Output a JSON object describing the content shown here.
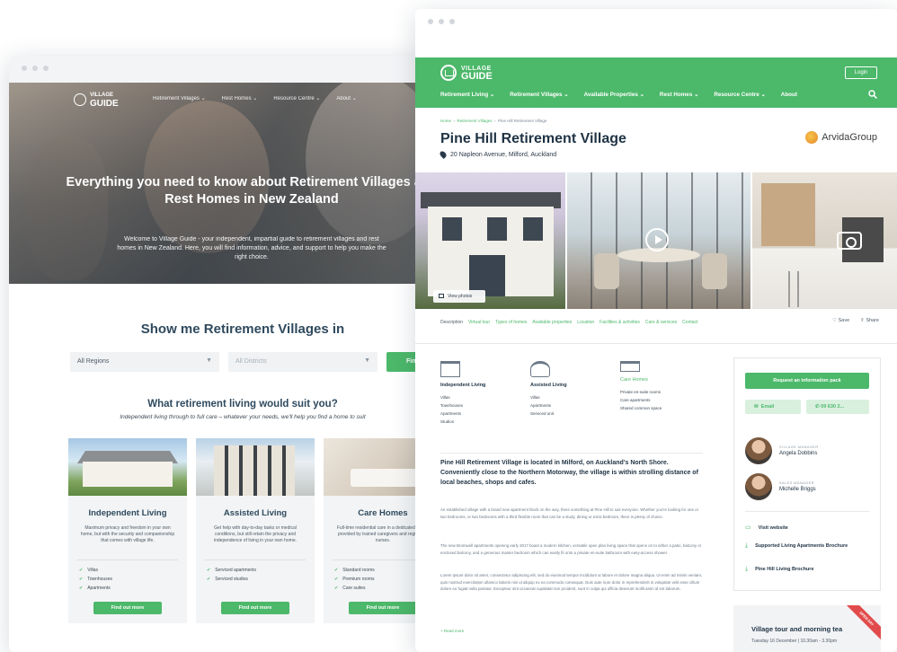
{
  "back_window": {
    "nav": {
      "logo_line1": "VILLAGE",
      "logo_line2": "GUIDE",
      "items": [
        "Retirement Villages ⌄",
        "Rest Homes ⌄",
        "Resource Centre ⌄",
        "About ⌄"
      ]
    },
    "hero": {
      "title": "Everything you need to know about Retirement Villages and Rest Homes in New Zealand",
      "subtitle": "Welcome to Village Guide - your independent, impartial guide to retirement villages and rest homes in New Zealand. Here, you will find information, advice, and support to help you make the right choice."
    },
    "search": {
      "heading": "Show me Retirement Villages in",
      "region": "All Regions",
      "district": "All Districts",
      "find_label": "Find"
    },
    "suit": {
      "heading": "What retirement living would suit you?",
      "subheading": "Independent living through to full care – whatever your needs, we'll help you find a home to suit"
    },
    "cards": [
      {
        "title": "Independent Living",
        "desc": "Maximum privacy and freedom in your own home, but with the security and companionship that comes with village life.",
        "items": [
          "Villas",
          "Townhouses",
          "Apartments"
        ],
        "cta": "Find out more"
      },
      {
        "title": "Assisted Living",
        "desc": "Get help with day-to-day tasks or medical conditions, but still retain the privacy and independence of living in your own home.",
        "items": [
          "Serviced apartments",
          "Serviced studios"
        ],
        "cta": "Find out more"
      },
      {
        "title": "Care Homes",
        "desc": "Full-time residential care in a dedicated facility provided by trained caregivers and registered nurses.",
        "items": [
          "Standard rooms",
          "Premium rooms",
          "Care suites"
        ],
        "cta": "Find out more"
      }
    ]
  },
  "front_window": {
    "nav": {
      "logo_line1": "VILLAGE",
      "logo_line2": "GUIDE",
      "login": "Login",
      "items": [
        "Retirement Living ⌄",
        "Retirement Villages ⌄",
        "Available Properties ⌄",
        "Rest Homes ⌄",
        "Resource Centre ⌄",
        "About"
      ]
    },
    "breadcrumb": [
      "Home",
      "Retirement Villages",
      "Pine Hill Retirement Village"
    ],
    "title": "Pine Hill Retirement Village",
    "address": "20 Napleon Avenue, Milford, Auckland",
    "operator": "ArvidaGroup",
    "view_photos": "View photos",
    "tabs": [
      "Description",
      "Virtual tour",
      "Types of homes",
      "Available properties",
      "Location",
      "Facilities & activities",
      "Care & services",
      "Contact"
    ],
    "tab_actions": [
      "Save",
      "Share"
    ],
    "types": [
      {
        "title": "Independent Living",
        "items": [
          "Villas",
          "Townhouses",
          "Apartments",
          "Studios"
        ]
      },
      {
        "title": "Assisted Living",
        "items": [
          "Villas",
          "Apartments",
          "Serviced unit"
        ]
      },
      {
        "title": "Care Homes",
        "items": [
          "Private en-suite rooms",
          "Care apartments",
          "Shared common space"
        ]
      }
    ],
    "lead": "Pine Hill Retirement Village is located in Milford, on Auckland's North Shore. Conveniently close to the Northern Motorway, the village is within strolling distance of local beaches, shops and cafes.",
    "paragraphs": [
      "An established village with a brand new apartment block on the way, there something at Pine Hill to suit everyone. Whether you're looking for one or two bedrooms, or two bedrooms with a third flexible room that can be a study, dining or extra bedroom, there is plenty of choice.",
      "The new Bromwell apartments opening early 2017 boast a modern kitchen, versatile open plan living space that opens on to either a patio, balcony or enclosed balcony, and a generous master bedroom which can easily fit onto a private en-suite bathroom with easy-access shower.",
      "Lorem ipsum dolor sit amet, consectetur adipiscing elit, sed do eiusmod tempor incididunt ut labore et dolore magna aliqua. Ut enim ad minim veniam, quis nostrud exercitation ullamco laboris nisi ut aliquip ex ea commodo consequat. Duis aute irure dolor in reprehenderit in voluptate velit esse cillum dolore eu fugiat nulla pariatur. Excepteur sint occaecat cupidatat non proident, sunt in culpa qui officia deserunt mollit anim id est laborum."
    ],
    "read_more": "+ Read more",
    "sidebar": {
      "request": "Request an information pack",
      "email": "Email",
      "phone": "09 630 2...",
      "people": [
        {
          "role": "VILLAGE MANAGER",
          "name": "Angela Dobbins"
        },
        {
          "role": "SALES MANAGER",
          "name": "Michelle Briggs"
        }
      ],
      "links": [
        "Visit website",
        "Supported Living Apartments Brochure",
        "Pine Hill Living Brochure"
      ]
    },
    "event": {
      "title": "Village tour and morning tea",
      "date": "Tuesday 16 December | 10.30am - 3.30pm",
      "ribbon": "OPEN DAY"
    }
  },
  "colors": {
    "brand_green": "#4cb86a",
    "navy": "#1f3344",
    "ribbon_red": "#e24b4b"
  }
}
